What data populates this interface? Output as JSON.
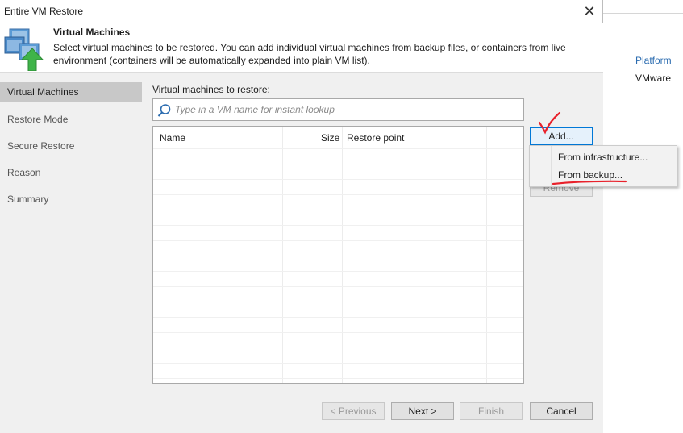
{
  "window": {
    "title": "Entire VM Restore"
  },
  "header": {
    "title": "Virtual Machines",
    "description": "Select virtual machines to be restored. You can add individual virtual machines from backup files, or containers from live environment (containers will be automatically expanded into plain VM list)."
  },
  "nav": {
    "items": [
      {
        "label": "Virtual Machines",
        "active": true
      },
      {
        "label": "Restore Mode",
        "active": false
      },
      {
        "label": "Secure Restore",
        "active": false
      },
      {
        "label": "Reason",
        "active": false
      },
      {
        "label": "Summary",
        "active": false
      }
    ]
  },
  "main": {
    "vm_label": "Virtual machines to restore:",
    "search_placeholder": "Type in a VM name for instant lookup",
    "table": {
      "columns": [
        "Name",
        "Size",
        "Restore point"
      ],
      "rows": []
    }
  },
  "buttons": {
    "add": "Add...",
    "remove": "Remove",
    "previous": "< Previous",
    "next": "Next >",
    "finish": "Finish",
    "cancel": "Cancel"
  },
  "add_menu": {
    "items": [
      "From infrastructure...",
      "From backup..."
    ]
  },
  "background_window": {
    "items": [
      "Platform",
      "VMware"
    ]
  },
  "colors": {
    "accent": "#0078d7",
    "annotation": "#e8212b",
    "nav_active": "#c8c8c8",
    "body_bg": "#f0f0f0"
  },
  "icons": {
    "header": "vm-restore-icon",
    "search": "search-icon",
    "close": "close-icon"
  }
}
